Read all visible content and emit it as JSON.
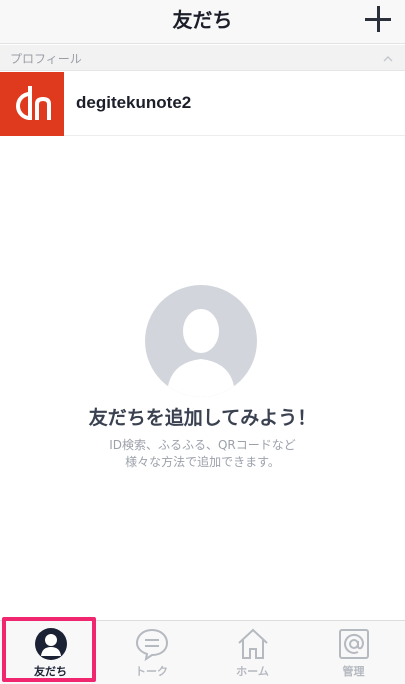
{
  "header": {
    "title": "友だち",
    "add_icon": "plus-icon"
  },
  "section": {
    "label": "プロフィール",
    "chevron_icon": "chevron-up-icon"
  },
  "profile": {
    "name": "degitekunote2",
    "avatar_color": "#e03a1e"
  },
  "empty_state": {
    "icon": "person-silhouette-icon",
    "heading": "友だちを追加してみよう！",
    "desc_line1": "ID検索、ふるふる、QRコードなど",
    "desc_line2": "様々な方法で追加できます。"
  },
  "tabs": [
    {
      "label": "友だち",
      "icon": "person-icon",
      "active": true
    },
    {
      "label": "トーク",
      "icon": "chat-bubble-icon",
      "active": false
    },
    {
      "label": "ホーム",
      "icon": "home-icon",
      "active": false
    },
    {
      "label": "管理",
      "icon": "at-sign-icon",
      "active": false
    }
  ],
  "colors": {
    "active_tab": "#1c2235",
    "inactive_tab": "#b5b9c0",
    "highlight": "#f0276e"
  }
}
